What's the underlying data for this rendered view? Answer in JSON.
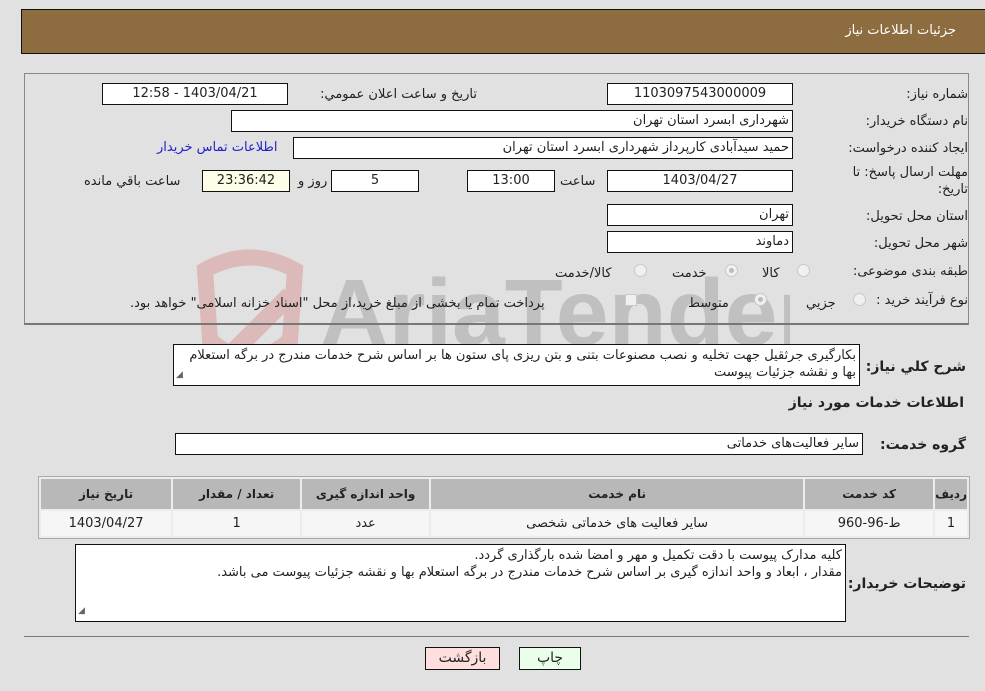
{
  "header": {
    "title": "جزئیات اطلاعات نیاز"
  },
  "form": {
    "need_number": {
      "label": "شماره نیاز:",
      "value": "1103097543000009"
    },
    "announce_datetime": {
      "label": "تاریخ و ساعت اعلان عمومي:",
      "value": "1403/04/21 - 12:58"
    },
    "buyer_org": {
      "label": "نام دستگاه خریدار:",
      "value": "شهرداری ابسرد استان تهران"
    },
    "requester": {
      "label": "ایجاد کننده درخواست:",
      "value": "حمید سیدآبادی کارپرداز شهرداری ابسرد استان تهران"
    },
    "contact_link": "اطلاعات تماس خریدار",
    "deadline": {
      "label_line1": "مهلت ارسال پاسخ: تا",
      "label_line2": "تاریخ:",
      "date": "1403/04/27",
      "time_label": "ساعت",
      "time": "13:00",
      "days": "5",
      "days_label": "روز و",
      "remaining": "23:36:42",
      "remaining_label": "ساعت باقي مانده"
    },
    "province": {
      "label": "استان محل تحویل:",
      "value": "تهران"
    },
    "city": {
      "label": "شهر محل تحویل:",
      "value": "دماوند"
    },
    "category": {
      "label": "طبقه بندی موضوعی:",
      "options": [
        "کالا",
        "خدمت",
        "کالا/خدمت"
      ],
      "selected": "خدمت"
    },
    "purchase_type": {
      "label": "نوع فرآیند خرید :",
      "options": [
        "جزيي",
        "متوسط"
      ],
      "selected": "متوسط",
      "payment_note": "پرداخت تمام یا بخشی از مبلغ خرید،از محل \"اسناد خزانه اسلامی\" خواهد بود.",
      "payment_checked": false
    }
  },
  "description": {
    "label": "شرح کلي نیاز:",
    "value": "بکارگیری جرثقیل جهت تخلیه و نصب مصنوعات بتنی و بتن ریزی پای ستون ها بر اساس شرح خدمات مندرج در برگه استعلام بها و نقشه جزئیات پیوست"
  },
  "services": {
    "section_title": "اطلاعات خدمات مورد نیاز",
    "group_label": "گروه خدمت:",
    "group_value": "سایر فعالیت‌های خدماتی",
    "table": {
      "headers": [
        "ردیف",
        "کد خدمت",
        "نام خدمت",
        "واحد اندازه گیری",
        "تعداد / مقدار",
        "تاریخ نیاز"
      ],
      "rows": [
        [
          "1",
          "ط-96-960",
          "سایر فعالیت های خدماتی شخصی",
          "عدد",
          "1",
          "1403/04/27"
        ]
      ]
    }
  },
  "buyer_notes": {
    "label": "توضیحات خریدار:",
    "line1": "کلیه مدارک پیوست با دقت تکمیل و مهر و امضا شده بارگذاری گردد.",
    "line2": "مقدار ، ابعاد و واحد اندازه گیری بر اساس  شرح خدمات مندرج در برگه استعلام بها و نقشه جزئیات پیوست می باشد."
  },
  "buttons": {
    "print": "چاپ",
    "back": "بازگشت"
  },
  "watermark": {
    "text": "AriaTender.neT"
  },
  "colors": {
    "header_bg": "#8d6c40",
    "print_bg": "#eaffea",
    "back_bg": "#ffdede",
    "link": "#2222cc"
  }
}
